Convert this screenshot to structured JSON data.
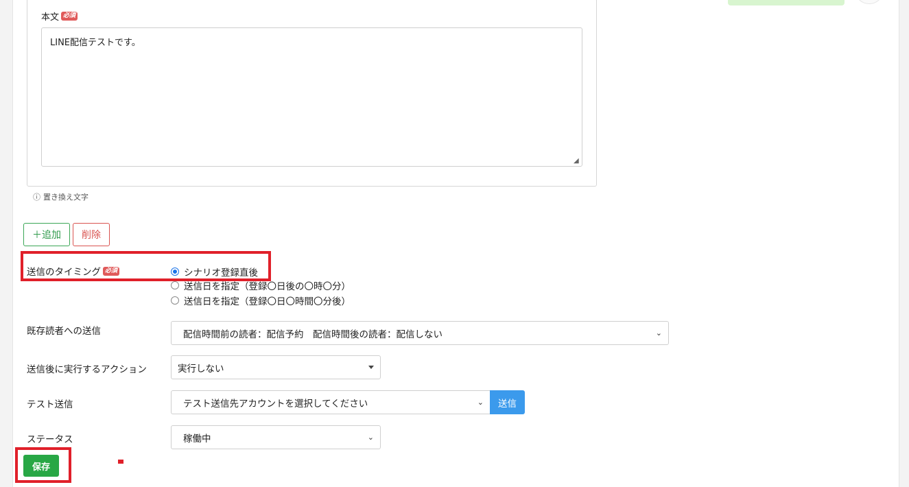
{
  "message": {
    "body_label": "本文",
    "required_badge": "必須",
    "body_text": "LINE配信テストです。",
    "hint": "置き換え文字"
  },
  "actions": {
    "add_label": "＋追加",
    "delete_label": "削除"
  },
  "timing": {
    "label": "送信のタイミング",
    "required_badge": "必須",
    "options": [
      {
        "label": "シナリオ登録直後",
        "checked": true
      },
      {
        "label": "送信日を指定（登録〇日後の〇時〇分）",
        "checked": false
      },
      {
        "label": "送信日を指定（登録〇日〇時間〇分後）",
        "checked": false
      }
    ]
  },
  "existing_readers": {
    "label": "既存読者への送信",
    "selected": "配信時間前の読者：配信予約　配信時間後の読者：配信しない"
  },
  "post_action": {
    "label": "送信後に実行するアクション",
    "selected": "実行しない"
  },
  "test_send": {
    "label": "テスト送信",
    "placeholder": "テスト送信先アカウントを選択してください",
    "send_label": "送信"
  },
  "status": {
    "label": "ステータス",
    "selected": "稼働中"
  },
  "save_label": "保存",
  "colors": {
    "highlight": "#e0202a",
    "success": "#28a745",
    "primary": "#3b9aec",
    "danger": "#d9534f"
  }
}
